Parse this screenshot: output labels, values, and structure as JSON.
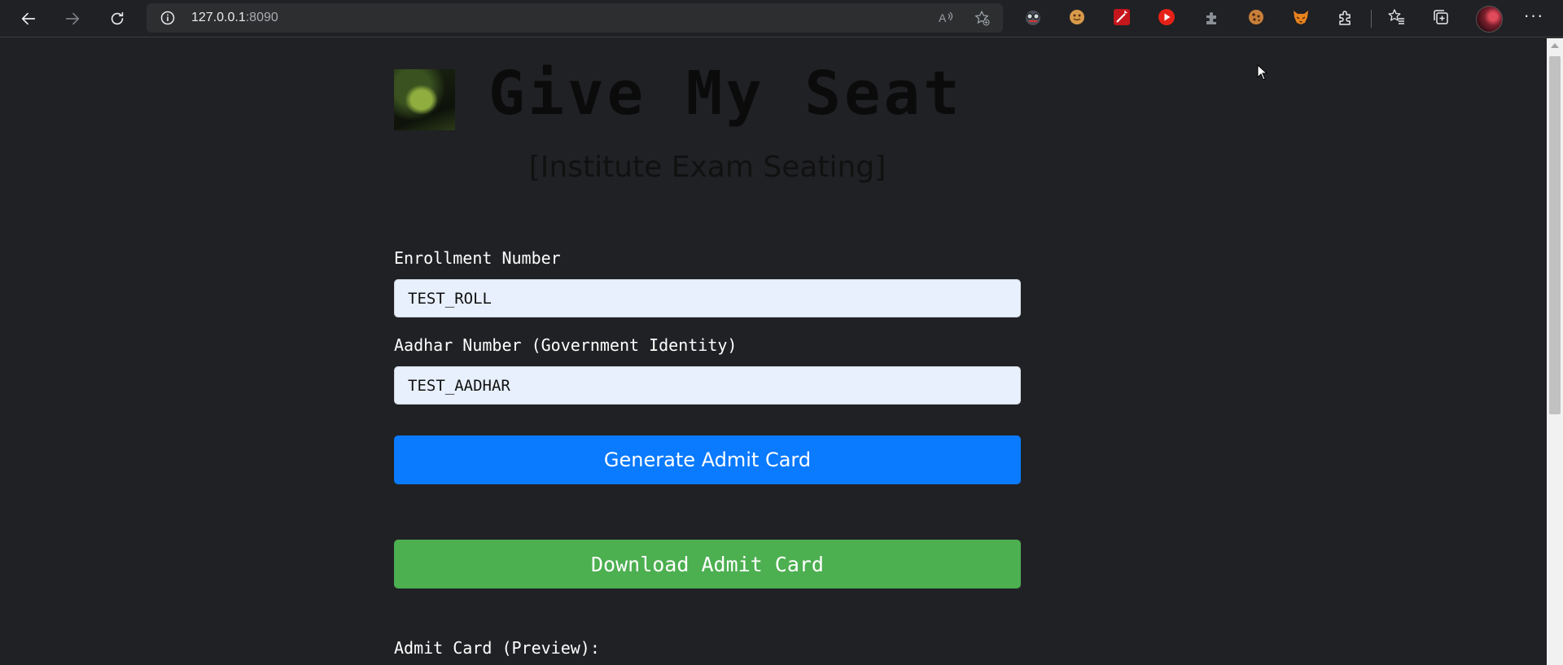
{
  "browser": {
    "url_host": "127.0.0.1",
    "url_port": ":8090"
  },
  "extensions": [
    "glasses-face-icon",
    "cookie-face-icon",
    "magic-wand-icon",
    "youtube-icon",
    "puzzle-gray-icon",
    "cookie-icon",
    "fox-icon",
    "extensions-icon"
  ],
  "page": {
    "title": "Give My Seat",
    "subtitle": "[Institute Exam Seating]",
    "enrollment_label": "Enrollment Number",
    "enrollment_value": "TEST_ROLL",
    "aadhar_label": "Aadhar Number (Government Identity)",
    "aadhar_value": "TEST_AADHAR",
    "generate_button": "Generate Admit Card",
    "download_button": "Download Admit Card",
    "preview_label": "Admit Card (Preview):"
  },
  "colors": {
    "background": "#202124",
    "generate_button": "#0a7aff",
    "download_button": "#4caf50",
    "input_bg": "#e8f0fe"
  }
}
